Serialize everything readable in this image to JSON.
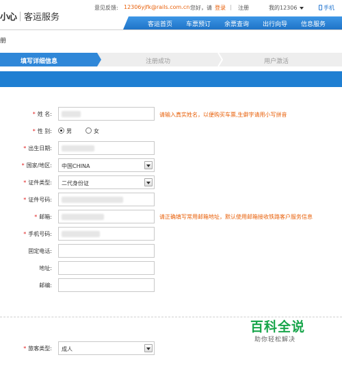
{
  "header": {
    "logo_mark": "小心",
    "logo_text": "客运服务",
    "feedback_label": "意见反馈:",
    "feedback_email": "12306yjfk@rails.com.cn",
    "greeting": "您好，请",
    "login": "登录",
    "divider": "|",
    "register": "注册",
    "my_account": "我的12306",
    "mobile": "手机"
  },
  "nav": {
    "items": [
      "客运首页",
      "车票预订",
      "余票查询",
      "出行向导",
      "信息服务"
    ]
  },
  "corner_char": "册",
  "steps": {
    "items": [
      "填写详细信息",
      "注册成功",
      "用户激活"
    ]
  },
  "form": {
    "name": {
      "label": "姓  名:",
      "hint": "请输入真实姓名，以便购买车票,生僻字请用小写拼音"
    },
    "gender": {
      "label": "性  别:",
      "male": "男",
      "female": "女"
    },
    "birth": {
      "label": "出生日期:"
    },
    "country": {
      "label": "国家/地区:",
      "value": "中国CHINA"
    },
    "id_type": {
      "label": "证件类型:",
      "value": "二代身份证"
    },
    "id_number": {
      "label": "证件号码:"
    },
    "email": {
      "label": "邮箱:",
      "hint": "请正确填写常用邮箱地址，默认使用邮箱接收铁路客户服务信息"
    },
    "mobile": {
      "label": "手机号码:"
    },
    "phone": {
      "label": "固定电话:"
    },
    "address": {
      "label": "地址:"
    },
    "zip": {
      "label": "邮编:"
    },
    "passenger_type": {
      "label": "旅客类型:",
      "value": "成人"
    },
    "required_mark": "*"
  },
  "watermark": {
    "title": "百科全说",
    "subtitle": "助你轻松解决"
  },
  "colors": {
    "nav_blue": "#1f73c7",
    "accent_orange": "#e8600a",
    "required_red": "#e02020",
    "watermark_green": "#17a54a"
  }
}
